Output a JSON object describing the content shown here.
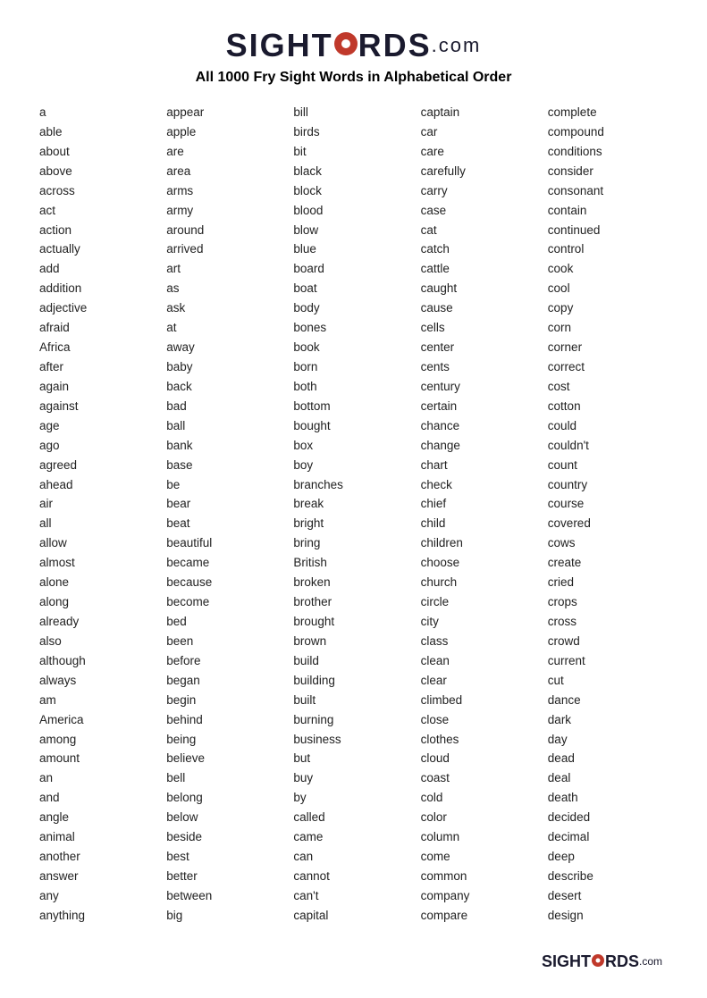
{
  "header": {
    "logo_sight": "SIGHT",
    "logo_words": "W RDS",
    "logo_dotcom": ".com",
    "subtitle": "All 1000 Fry Sight Words in Alphabetical Order"
  },
  "columns": [
    [
      "a",
      "able",
      "about",
      "above",
      "across",
      "act",
      "action",
      "actually",
      "add",
      "addition",
      "adjective",
      "afraid",
      "Africa",
      "after",
      "again",
      "against",
      "age",
      "ago",
      "agreed",
      "ahead",
      "air",
      "all",
      "allow",
      "almost",
      "alone",
      "along",
      "already",
      "also",
      "although",
      "always",
      "am",
      "America",
      "among",
      "amount",
      "an",
      "and",
      "angle",
      "animal",
      "another",
      "answer",
      "any",
      "anything"
    ],
    [
      "appear",
      "apple",
      "are",
      "area",
      "arms",
      "army",
      "around",
      "arrived",
      "art",
      "as",
      "ask",
      "at",
      "away",
      "baby",
      "back",
      "bad",
      "ball",
      "bank",
      "base",
      "be",
      "bear",
      "beat",
      "beautiful",
      "became",
      "because",
      "become",
      "bed",
      "been",
      "before",
      "began",
      "begin",
      "behind",
      "being",
      "believe",
      "bell",
      "belong",
      "below",
      "beside",
      "best",
      "better",
      "between",
      "big"
    ],
    [
      "bill",
      "birds",
      "bit",
      "black",
      "block",
      "blood",
      "blow",
      "blue",
      "board",
      "boat",
      "body",
      "bones",
      "book",
      "born",
      "both",
      "bottom",
      "bought",
      "box",
      "boy",
      "branches",
      "break",
      "bright",
      "bring",
      "British",
      "broken",
      "brother",
      "brought",
      "brown",
      "build",
      "building",
      "built",
      "burning",
      "business",
      "but",
      "buy",
      "by",
      "called",
      "came",
      "can",
      "cannot",
      "can't",
      "capital"
    ],
    [
      "captain",
      "car",
      "care",
      "carefully",
      "carry",
      "case",
      "cat",
      "catch",
      "cattle",
      "caught",
      "cause",
      "cells",
      "center",
      "cents",
      "century",
      "certain",
      "chance",
      "change",
      "chart",
      "check",
      "chief",
      "child",
      "children",
      "choose",
      "church",
      "circle",
      "city",
      "class",
      "clean",
      "clear",
      "climbed",
      "close",
      "clothes",
      "cloud",
      "coast",
      "cold",
      "color",
      "column",
      "come",
      "common",
      "company",
      "compare"
    ],
    [
      "complete",
      "compound",
      "conditions",
      "consider",
      "consonant",
      "contain",
      "continued",
      "control",
      "cook",
      "cool",
      "copy",
      "corn",
      "corner",
      "correct",
      "cost",
      "cotton",
      "could",
      "couldn't",
      "count",
      "country",
      "course",
      "covered",
      "cows",
      "create",
      "cried",
      "crops",
      "cross",
      "crowd",
      "current",
      "cut",
      "dance",
      "dark",
      "day",
      "dead",
      "deal",
      "death",
      "decided",
      "decimal",
      "deep",
      "describe",
      "desert",
      "design"
    ]
  ],
  "footer": {
    "logo_sight": "SIGHT",
    "logo_words": "W RDS",
    "logo_dotcom": ".com"
  }
}
